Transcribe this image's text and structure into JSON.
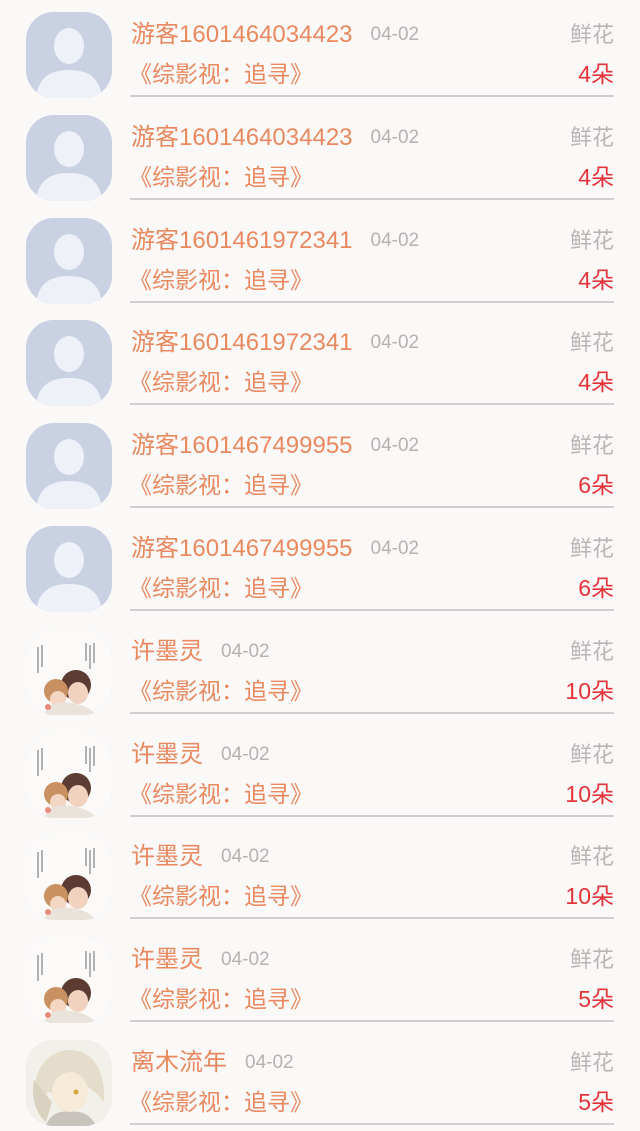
{
  "colors": {
    "name": "#e8895f",
    "count": "#e5333a",
    "muted": "#b5b2b2",
    "default_avatar_bg": "#c9d1e3"
  },
  "rows": [
    {
      "user": "游客1601464034423",
      "date": "04-02",
      "gift": "鲜花",
      "book": "《综影视：追寻》",
      "count": "4朵",
      "avatar": "default-avatar"
    },
    {
      "user": "游客1601464034423",
      "date": "04-02",
      "gift": "鲜花",
      "book": "《综影视：追寻》",
      "count": "4朵",
      "avatar": "default-avatar"
    },
    {
      "user": "游客1601461972341",
      "date": "04-02",
      "gift": "鲜花",
      "book": "《综影视：追寻》",
      "count": "4朵",
      "avatar": "default-avatar"
    },
    {
      "user": "游客1601461972341",
      "date": "04-02",
      "gift": "鲜花",
      "book": "《综影视：追寻》",
      "count": "4朵",
      "avatar": "default-avatar"
    },
    {
      "user": "游客1601467499955",
      "date": "04-02",
      "gift": "鲜花",
      "book": "《综影视：追寻》",
      "count": "6朵",
      "avatar": "default-avatar"
    },
    {
      "user": "游客1601467499955",
      "date": "04-02",
      "gift": "鲜花",
      "book": "《综影视：追寻》",
      "count": "6朵",
      "avatar": "default-avatar"
    },
    {
      "user": "许墨灵",
      "date": "04-02",
      "gift": "鲜花",
      "book": "《综影视：追寻》",
      "count": "10朵",
      "avatar": "illustrated-avatar"
    },
    {
      "user": "许墨灵",
      "date": "04-02",
      "gift": "鲜花",
      "book": "《综影视：追寻》",
      "count": "10朵",
      "avatar": "illustrated-avatar"
    },
    {
      "user": "许墨灵",
      "date": "04-02",
      "gift": "鲜花",
      "book": "《综影视：追寻》",
      "count": "10朵",
      "avatar": "illustrated-avatar"
    },
    {
      "user": "许墨灵",
      "date": "04-02",
      "gift": "鲜花",
      "book": "《综影视：追寻》",
      "count": "5朵",
      "avatar": "illustrated-avatar"
    },
    {
      "user": "离木流年",
      "date": "04-02",
      "gift": "鲜花",
      "book": "《综影视：追寻》",
      "count": "5朵",
      "avatar": "anime-avatar"
    }
  ]
}
